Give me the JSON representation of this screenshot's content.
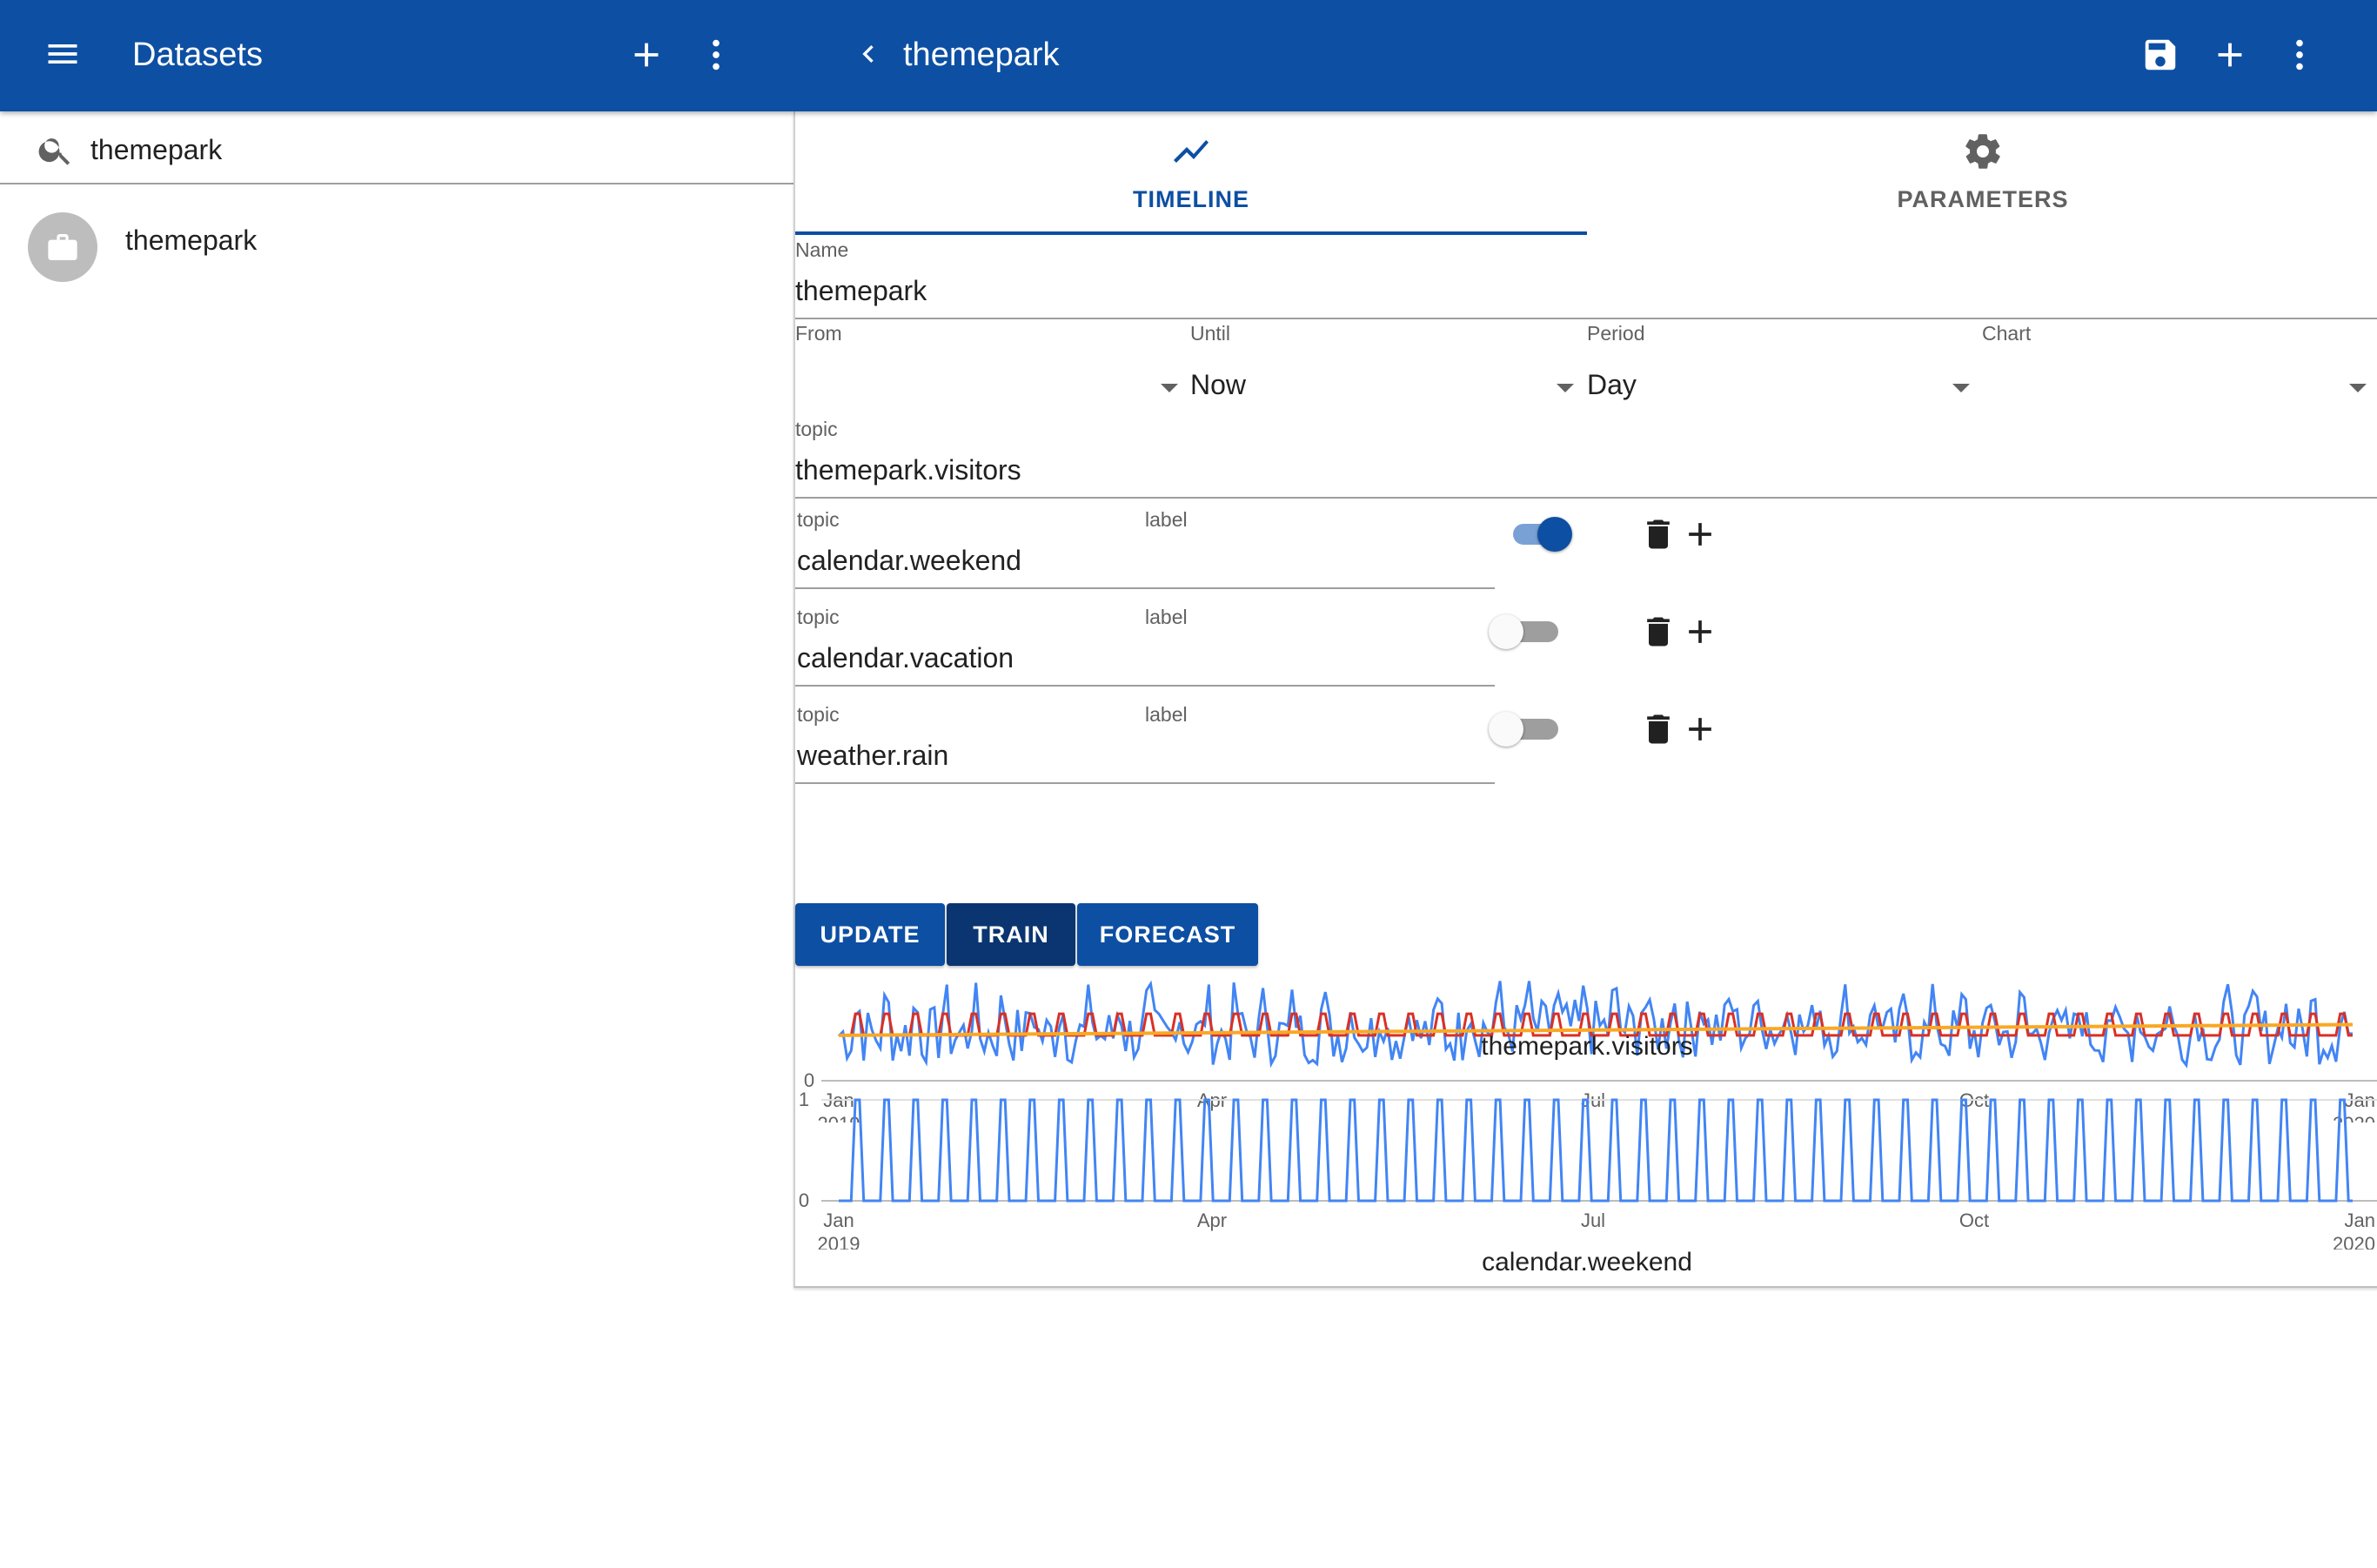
{
  "appbar": {
    "left_title": "Datasets",
    "right_title": "themepark",
    "color": "#0d4fa3",
    "icons": [
      "menu-icon",
      "add-icon",
      "more-vert-icon",
      "back-chevron-icon",
      "save-icon",
      "add-icon",
      "more-vert-icon"
    ]
  },
  "sidebar": {
    "search_value": "themepark",
    "items": [
      {
        "label": "themepark",
        "icon": "briefcase-icon"
      }
    ]
  },
  "tabs": [
    {
      "label": "TIMELINE",
      "icon": "timeline-icon",
      "active": true
    },
    {
      "label": "PARAMETERS",
      "icon": "gear-icon",
      "active": false
    }
  ],
  "form": {
    "name_label": "Name",
    "name_value": "themepark",
    "from_label": "From",
    "from_value": "",
    "until_label": "Until",
    "until_value": "Now",
    "period_label": "Period",
    "period_value": "Day",
    "chart_label": "Chart",
    "chart_value": "",
    "topic_label": "topic",
    "topic_value": "themepark.visitors"
  },
  "regressors": [
    {
      "topic_label": "topic",
      "topic": "calendar.weekend",
      "label_label": "label",
      "label": "",
      "enabled": true
    },
    {
      "topic_label": "topic",
      "topic": "calendar.vacation",
      "label_label": "label",
      "label": "",
      "enabled": false
    },
    {
      "topic_label": "topic",
      "topic": "weather.rain",
      "label_label": "label",
      "label": "",
      "enabled": false
    }
  ],
  "buttons": {
    "update": "UPDATE",
    "train": "TRAIN",
    "forecast": "FORECAST"
  },
  "chart_data": [
    {
      "type": "line",
      "title": "themepark.visitors",
      "xlabel": "",
      "ylabel": "",
      "x_ticks": [
        {
          "month": "Jan",
          "year": "2019"
        },
        {
          "month": "Apr",
          "year": ""
        },
        {
          "month": "Jul",
          "year": ""
        },
        {
          "month": "Oct",
          "year": ""
        },
        {
          "month": "Jan",
          "year": "2020"
        }
      ],
      "y_ticks": [
        "0"
      ],
      "x_range": [
        "2019-01-01",
        "2020-01-01"
      ],
      "series": [
        {
          "color": "#4285f4",
          "style": "noisy daily values, roughly 0 to 1.0 relative scale"
        },
        {
          "color": "#d93025",
          "style": "weekly square pulses between 0.42 and 0.62"
        },
        {
          "color": "#f9a825",
          "style": "slowly rising trend from 0.42 to 0.52"
        }
      ],
      "grid": true,
      "legend": "none"
    },
    {
      "type": "line",
      "title": "calendar.weekend",
      "xlabel": "",
      "ylabel": "",
      "x_ticks": [
        {
          "month": "Jan",
          "year": "2019"
        },
        {
          "month": "Apr",
          "year": ""
        },
        {
          "month": "Jul",
          "year": ""
        },
        {
          "month": "Oct",
          "year": ""
        },
        {
          "month": "Jan",
          "year": "2020"
        }
      ],
      "y_ticks": [
        "1",
        "0"
      ],
      "ylim": [
        0,
        1
      ],
      "x_range": [
        "2019-01-01",
        "2020-01-01"
      ],
      "series": [
        {
          "color": "#4285f4",
          "pattern": "weekly: 1 on Saturday and Sunday, 0 on weekdays",
          "start_weekday": "Tuesday",
          "days": 365
        }
      ],
      "grid": true,
      "legend": "none"
    }
  ]
}
